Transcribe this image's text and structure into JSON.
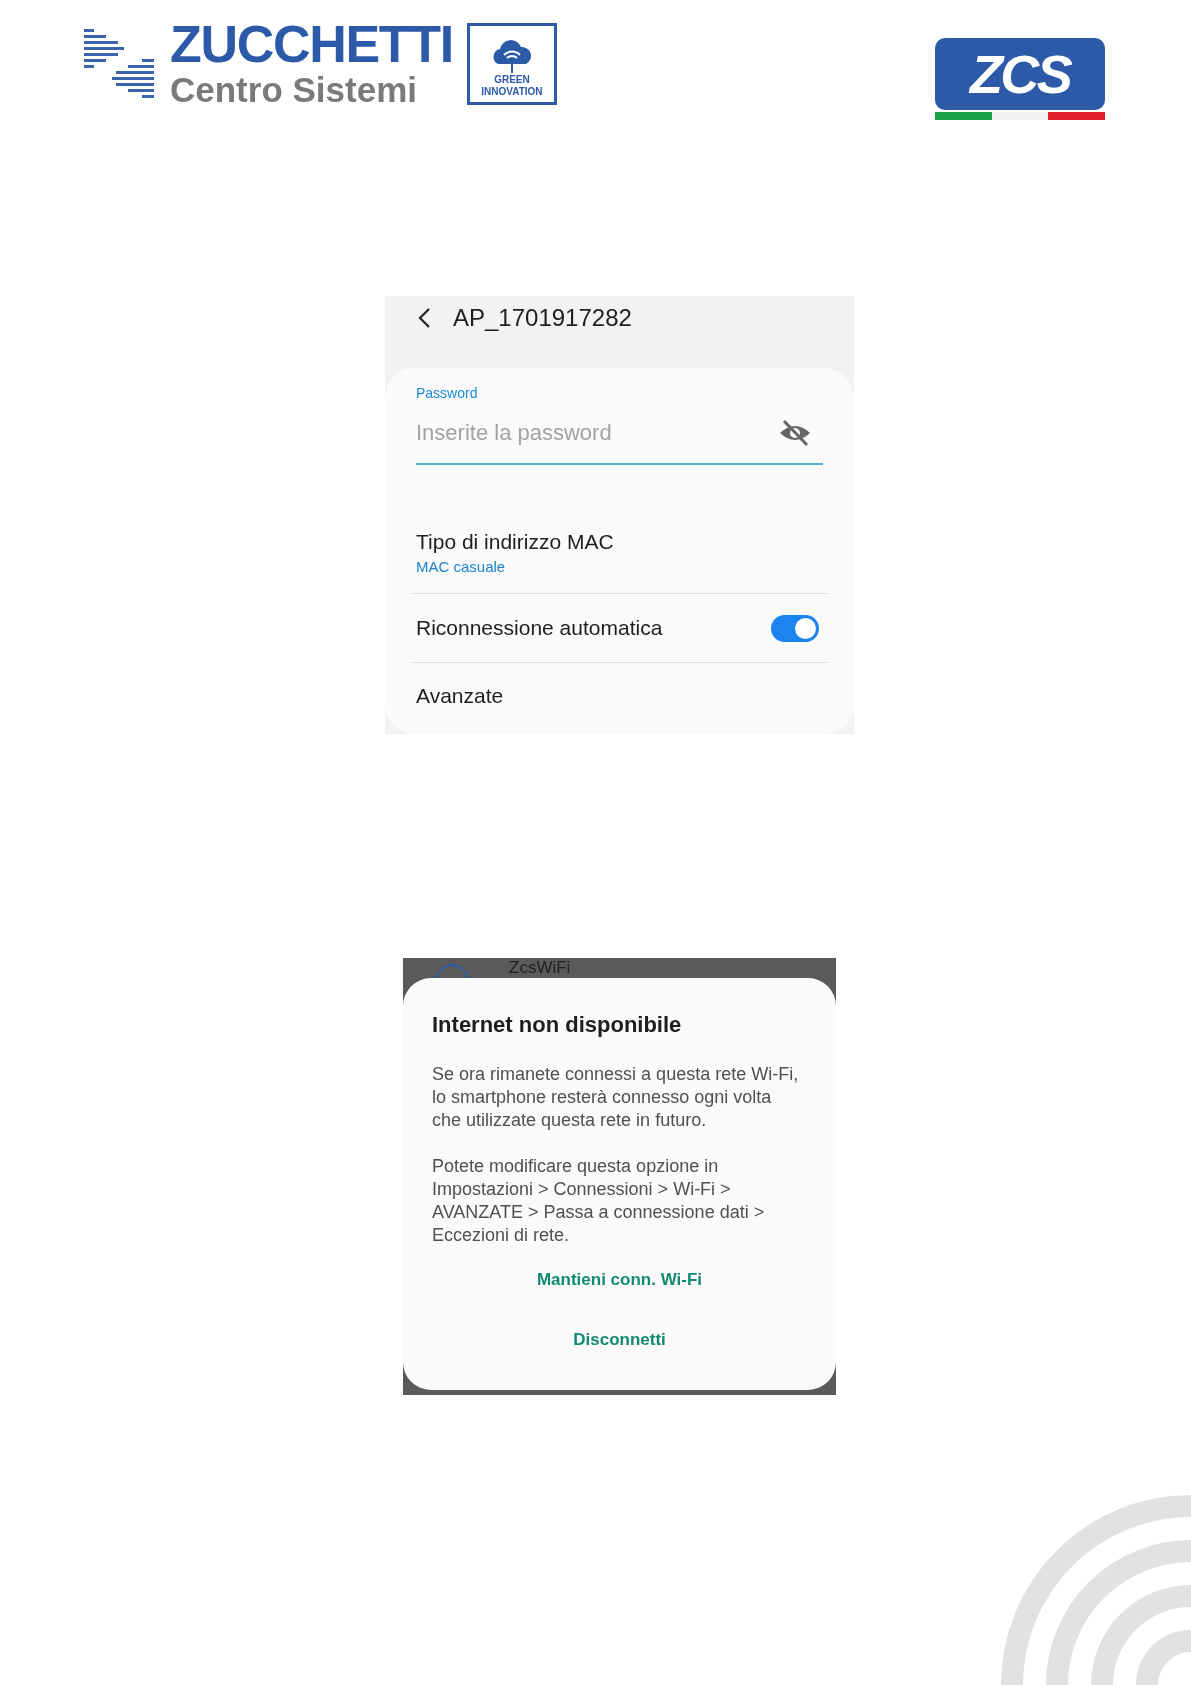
{
  "header": {
    "brand": {
      "name": "ZUCCHETTI",
      "subname": "Centro Sistemi",
      "badge": [
        "GREEN",
        "INNOVATION"
      ]
    },
    "right_logo": {
      "text": "ZCS"
    }
  },
  "screen_1": {
    "title": "AP_1701917282",
    "password_field": {
      "label": "Password",
      "placeholder": "Inserite la password"
    },
    "rows": [
      {
        "kind": "detail",
        "label": "Tipo di indirizzo MAC",
        "value": "MAC casuale"
      },
      {
        "kind": "toggle",
        "label": "Riconnessione automatica",
        "on": true
      },
      {
        "kind": "plain",
        "label": "Avanzate"
      }
    ]
  },
  "screen_2": {
    "background_item": "ZcsWiFi",
    "dialog": {
      "title": "Internet non disponibile",
      "paragraphs": [
        "Se ora rimanete connessi a questa rete Wi-Fi, lo smartphone resterà connesso ogni volta che utilizzate questa rete in futuro.",
        "Potete modificare questa opzione in Impostazioni > Connessioni > Wi-Fi > AVANZATE > Passa a connessione dati > Eccezioni di rete."
      ],
      "buttons": [
        "Mantieni conn. Wi-Fi",
        "Disconnetti"
      ]
    }
  }
}
